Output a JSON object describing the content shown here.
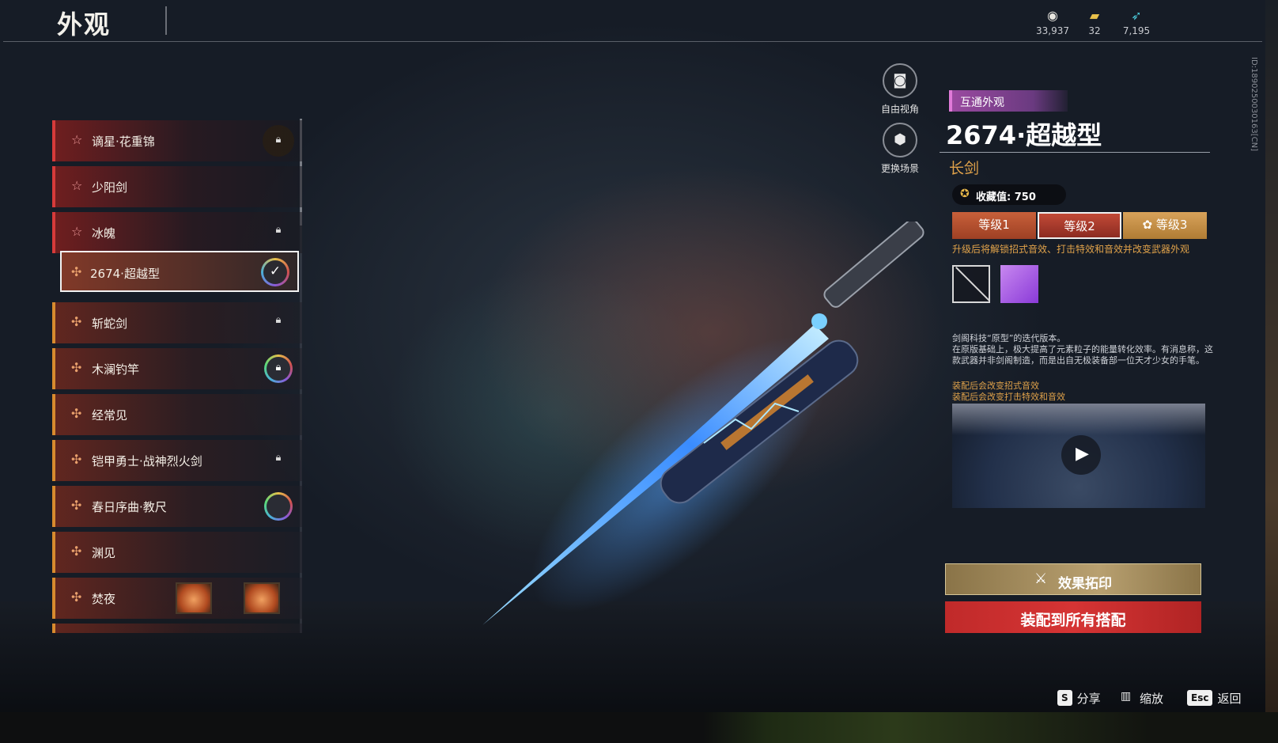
{
  "header": {
    "title": "外观",
    "currencies": [
      {
        "icon": "coin-icon",
        "value": "33,937"
      },
      {
        "icon": "ticket-icon",
        "value": "32"
      },
      {
        "icon": "feather-icon",
        "value": "7,195"
      }
    ]
  },
  "list": {
    "items": [
      {
        "label": "谪星·花重锦",
        "status": "locked"
      },
      {
        "label": "少阳剑",
        "status": "none"
      },
      {
        "label": "冰魄",
        "status": "locked"
      },
      {
        "label": "2674·超越型",
        "status": "selected-equipped"
      },
      {
        "label": "斩蛇剑",
        "status": "locked"
      },
      {
        "label": "木澜钓竿",
        "status": "ring-locked"
      },
      {
        "label": "经常见",
        "status": "none"
      },
      {
        "label": "铠甲勇士·战神烈火剑",
        "status": "locked"
      },
      {
        "label": "春日序曲·教尺",
        "status": "ring"
      },
      {
        "label": "渊见",
        "status": "none"
      },
      {
        "label": "焚夜",
        "status": "lanterns"
      }
    ]
  },
  "view_controls": {
    "free_view": "自由视角",
    "change_scene": "更换场景"
  },
  "detail": {
    "tag": "互通外观",
    "name": "2674·超越型",
    "type": "长剑",
    "collection_label": "收藏值: 750",
    "tiers": [
      "等级1",
      "等级2",
      "等级3"
    ],
    "selected_tier": "等级2",
    "upgrade_note": "升级后将解锁招式音效、打击特效和音效并改变武器外观",
    "description_line1": "剑阁科技“原型”的迭代版本。",
    "description_line2": "在原版基础上，极大提高了元素粒子的能量转化效率。有消息称，这款武器并非剑阁制造，而是出自无极装备部一位天才少女的手笔。",
    "effect_note1": "装配后会改变招式音效",
    "effect_note2": "装配后会改变打击特效和音效"
  },
  "actions": {
    "imprint": "效果拓印",
    "equip_all": "装配到所有搭配"
  },
  "hints": [
    {
      "key": "S",
      "label": "分享"
    },
    {
      "key": "",
      "label": "缩放"
    },
    {
      "key": "Esc",
      "label": "返回"
    }
  ],
  "build_id": "ID:1890250030163[CN]",
  "colors": {
    "accent_orange": "#e0a24a",
    "equip_red": "#d63434",
    "tag_purple": "#9a4aa0"
  }
}
